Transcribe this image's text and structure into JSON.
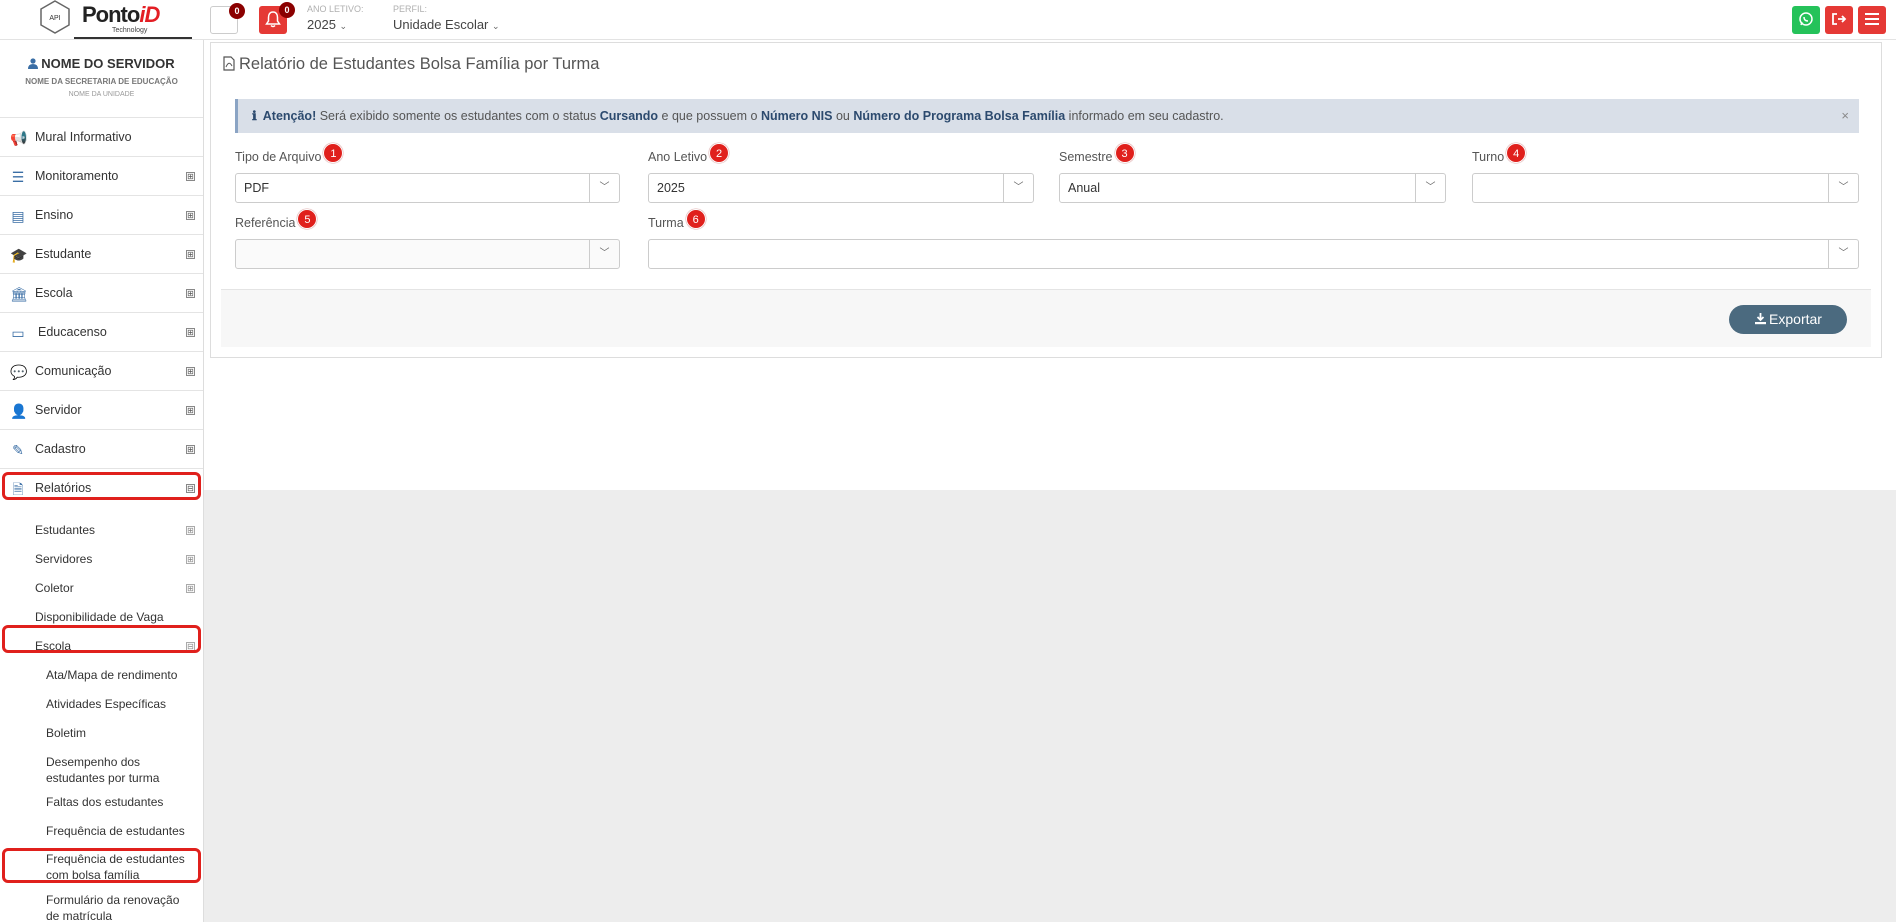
{
  "brand": {
    "name": "Ponto",
    "name_accent": "iD",
    "sub": "Technology",
    "hex": "API"
  },
  "topbar": {
    "doc_count": "0",
    "bell_count": "0",
    "ano_letivo_label": "ANO LETIVO:",
    "ano_letivo_value": "2025",
    "perfil_label": "PERFIL:",
    "perfil_value": "Unidade Escolar"
  },
  "user": {
    "name": "NOME DO SERVIDOR",
    "secretaria": "NOME DA SECRETARIA DE EDUCAÇÃO",
    "unidade": "NOME DA UNIDADE"
  },
  "menu": [
    {
      "label": "Mural Informativo",
      "icon": "megaphone-icon",
      "expander": ""
    },
    {
      "label": "Monitoramento",
      "icon": "sliders-icon",
      "expander": "⊞"
    },
    {
      "label": "Ensino",
      "icon": "book-icon",
      "expander": "⊞"
    },
    {
      "label": "Estudante",
      "icon": "graduation-cap-icon",
      "expander": "⊞"
    },
    {
      "label": "Escola",
      "icon": "bank-icon",
      "expander": "⊞"
    },
    {
      "label": "Educacenso",
      "icon": "monitor-icon",
      "expander": "⊞"
    },
    {
      "label": "Comunicação",
      "icon": "chat-icon",
      "expander": "⊞"
    },
    {
      "label": "Servidor",
      "icon": "user-icon",
      "expander": "⊞"
    },
    {
      "label": "Cadastro",
      "icon": "edit-icon",
      "expander": "⊞"
    },
    {
      "label": "Relatórios",
      "icon": "file-icon",
      "expander": "⊟"
    }
  ],
  "relatorios_sub": [
    {
      "label": "Estudantes",
      "expander": "⊞"
    },
    {
      "label": "Servidores",
      "expander": "⊞"
    },
    {
      "label": "Coletor",
      "expander": "⊞"
    },
    {
      "label": "Disponibilidade de Vaga",
      "expander": ""
    },
    {
      "label": "Escola",
      "expander": "⊟"
    }
  ],
  "escola_sub": [
    {
      "line1": "Ata/Mapa de rendimento",
      "line2": ""
    },
    {
      "line1": "Atividades Específicas",
      "line2": ""
    },
    {
      "line1": "Boletim",
      "line2": ""
    },
    {
      "line1": "Desempenho dos",
      "line2": "estudantes por turma"
    },
    {
      "line1": "Faltas dos estudantes",
      "line2": ""
    },
    {
      "line1": "Frequência de estudantes",
      "line2": ""
    },
    {
      "line1": "Frequência de estudantes",
      "line2": "com bolsa família"
    },
    {
      "line1": "Formulário da renovação",
      "line2": "de matrícula"
    }
  ],
  "page": {
    "title": "Relatório de Estudantes Bolsa Família por Turma",
    "alert": {
      "prefix": "Atenção!",
      "t1": " Será exibido somente os estudantes com o status ",
      "b1": "Cursando",
      "t2": " e que possuem o ",
      "b2": "Número NIS",
      "t3": " ou ",
      "b3": "Número do Programa Bolsa Família",
      "t4": " informado em seu cadastro.",
      "close": "×"
    },
    "fields": [
      {
        "label": "Tipo de Arquivo",
        "badge": "1",
        "value": "PDF"
      },
      {
        "label": "Ano Letivo",
        "badge": "2",
        "value": "2025"
      },
      {
        "label": "Semestre",
        "badge": "3",
        "value": "Anual"
      },
      {
        "label": "Turno",
        "badge": "4",
        "value": ""
      },
      {
        "label": "Referência",
        "badge": "5",
        "value": ""
      },
      {
        "label": "Turma",
        "badge": "6",
        "value": ""
      }
    ],
    "export_label": "Exportar"
  }
}
